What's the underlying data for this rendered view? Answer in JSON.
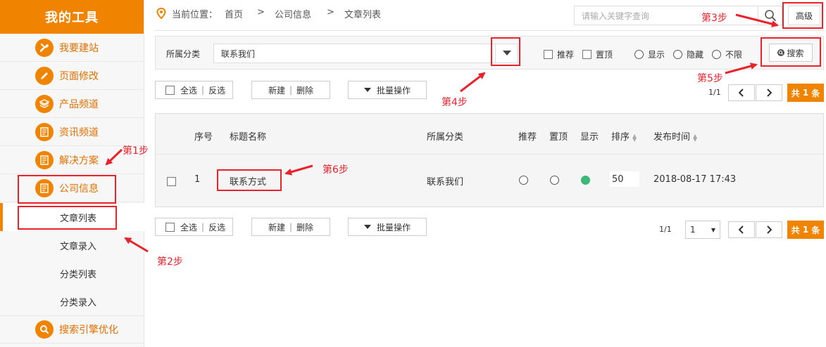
{
  "sidebar": {
    "title": "我的工具",
    "items": [
      {
        "label": "我要建站",
        "icon": "tools-icon"
      },
      {
        "label": "页面修改",
        "icon": "pencil-icon"
      },
      {
        "label": "产品频道",
        "icon": "box-icon"
      },
      {
        "label": "资讯频道",
        "icon": "news-icon"
      },
      {
        "label": "解决方案",
        "icon": "news-icon"
      },
      {
        "label": "公司信息",
        "icon": "news-icon"
      }
    ],
    "subitems": [
      "文章列表",
      "文章录入",
      "分类列表",
      "分类录入"
    ],
    "bottom_item": {
      "label": "搜索引擎优化",
      "icon": "search-icon"
    }
  },
  "breadcrumb": {
    "prefix": "当前位置：",
    "items": [
      "首页",
      "公司信息",
      "文章列表"
    ],
    "separator": ">"
  },
  "search": {
    "placeholder": "请输入关键字查询",
    "advanced_label": "高级"
  },
  "filter": {
    "category_label": "所属分类",
    "category_value": "联系我们",
    "checkboxes": [
      "推荐",
      "置顶"
    ],
    "radios": [
      "显示",
      "隐藏",
      "不限"
    ],
    "search_label": "搜索"
  },
  "actions": {
    "select_all": "全选",
    "invert": "反选",
    "new": "新建",
    "delete": "删除",
    "batch": "批量操作",
    "divider": "|"
  },
  "pager": {
    "top_page": "1/1",
    "bottom_page": "1/1",
    "page_select": "1",
    "total_prefix": "共",
    "total_count": "1",
    "total_suffix": "条"
  },
  "table": {
    "columns": [
      "序号",
      "标题名称",
      "所属分类",
      "推荐",
      "置顶",
      "显示",
      "排序",
      "发布时间"
    ],
    "rows": [
      {
        "index": "1",
        "title": "联系方式",
        "category": "联系我们",
        "recommend": false,
        "top": false,
        "show": true,
        "order": "50",
        "date": "2018-08-17 17:43"
      }
    ]
  },
  "annotations": {
    "step1": "第1步",
    "step2": "第2步",
    "step3": "第3步",
    "step4": "第4步",
    "step5": "第5步",
    "step6": "第6步"
  },
  "colors": {
    "brand": "#f08300",
    "annotation": "#e8232c",
    "show_on": "#3cb878"
  }
}
